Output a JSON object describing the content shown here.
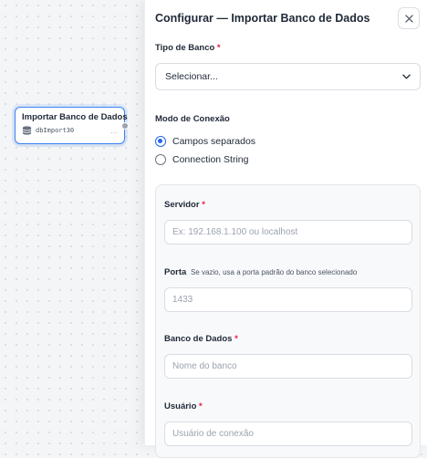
{
  "canvas": {
    "node": {
      "title": "Importar Banco de Dados",
      "subtitle": "dbImport30",
      "menu_glyph": "…"
    }
  },
  "panel": {
    "title": "Configurar — Importar Banco de Dados",
    "close_glyph": "×",
    "db_type": {
      "label": "Tipo de Banco",
      "required_mark": "*",
      "selected": "Selecionar..."
    },
    "connection_mode": {
      "label": "Modo de Conexão",
      "options": [
        {
          "label": "Campos separados",
          "checked": true
        },
        {
          "label": "Connection String",
          "checked": false
        }
      ]
    },
    "fields": {
      "server": {
        "label": "Servidor",
        "required_mark": "*",
        "placeholder": "Ex: 192.168.1.100 ou localhost"
      },
      "port": {
        "label": "Porta",
        "hint": "Se vazio, usa a porta padrão do banco selecionado",
        "placeholder": "1433"
      },
      "database": {
        "label": "Banco de Dados",
        "required_mark": "*",
        "placeholder": "Nome do banco"
      },
      "user": {
        "label": "Usuário",
        "required_mark": "*",
        "placeholder": "Usuário de conexão"
      }
    }
  },
  "colors": {
    "accent": "#2563eb",
    "required": "#e11d48",
    "node_border": "#3b82f6"
  },
  "icons": {
    "node_icon": "database-icon",
    "close": "close-icon",
    "select_arrow": "chevron-down-icon"
  }
}
